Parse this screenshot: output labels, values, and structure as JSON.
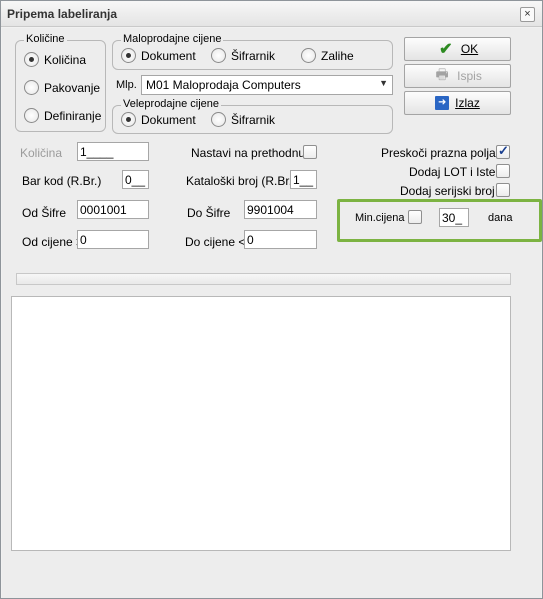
{
  "window": {
    "title": "Pripema labeliranja",
    "close_glyph": "×"
  },
  "kolicine_group": {
    "legend": "Količine",
    "options": [
      {
        "label": "Količina",
        "checked": true
      },
      {
        "label": "Pakovanje",
        "checked": false
      },
      {
        "label": "Definiranje",
        "checked": false
      }
    ]
  },
  "maloprodajne_group": {
    "legend": "Maloprodajne cijene",
    "options": [
      {
        "label": "Dokument",
        "checked": true
      },
      {
        "label": "Šifrarnik",
        "checked": false
      },
      {
        "label": "Zalihe",
        "checked": false
      }
    ],
    "mlp_label": "Mlp.",
    "mlp_value": "M01 Maloprodaja Computers"
  },
  "veleprodajne_group": {
    "legend": "Veleprodajne cijene",
    "options": [
      {
        "label": "Dokument",
        "checked": true
      },
      {
        "label": "Šifrarnik",
        "checked": false
      }
    ]
  },
  "buttons": {
    "ok": {
      "label": "OK",
      "icon": "checkmark-icon"
    },
    "ispis": {
      "label": "Ispis",
      "icon": "printer-icon"
    },
    "izlaz": {
      "label": "Izlaz",
      "icon": "exit-icon"
    }
  },
  "fields": {
    "kolicina_label": "Količina",
    "kolicina_value": "1____",
    "nastavi_label": "Nastavi na prethodnu",
    "bar_kod_label": "Bar kod (R.Br.)",
    "bar_kod_value": "0__",
    "katalosski_label": "Kataloški broj (R.Br.)",
    "katalosski_value": "1__",
    "od_sifre_label": "Od Šifre",
    "od_sifre_value": "0001001",
    "do_sifre_label": "Do Šifre",
    "do_sifre_value": "9901004",
    "od_cijene_label": "Od cijene >",
    "od_cijene_value": "0",
    "do_cijene_label": "Do cijene <",
    "do_cijene_value": "0"
  },
  "options_right": {
    "preskoci_label": "Preskoči prazna polja",
    "preskoci_checked": true,
    "dodaj_lot_label": "Dodaj LOT i Istek",
    "dodaj_lot_checked": false,
    "dodaj_serijski_label": "Dodaj serijski broj",
    "dodaj_serijski_checked": false
  },
  "min_cijena": {
    "label": "Min.cijena",
    "checked": false,
    "days_value": "30_",
    "days_label": "dana"
  },
  "colors": {
    "highlight_border": "#7cb342",
    "ok_icon": "#2e8b22",
    "exit_icon": "#2a66c4"
  }
}
